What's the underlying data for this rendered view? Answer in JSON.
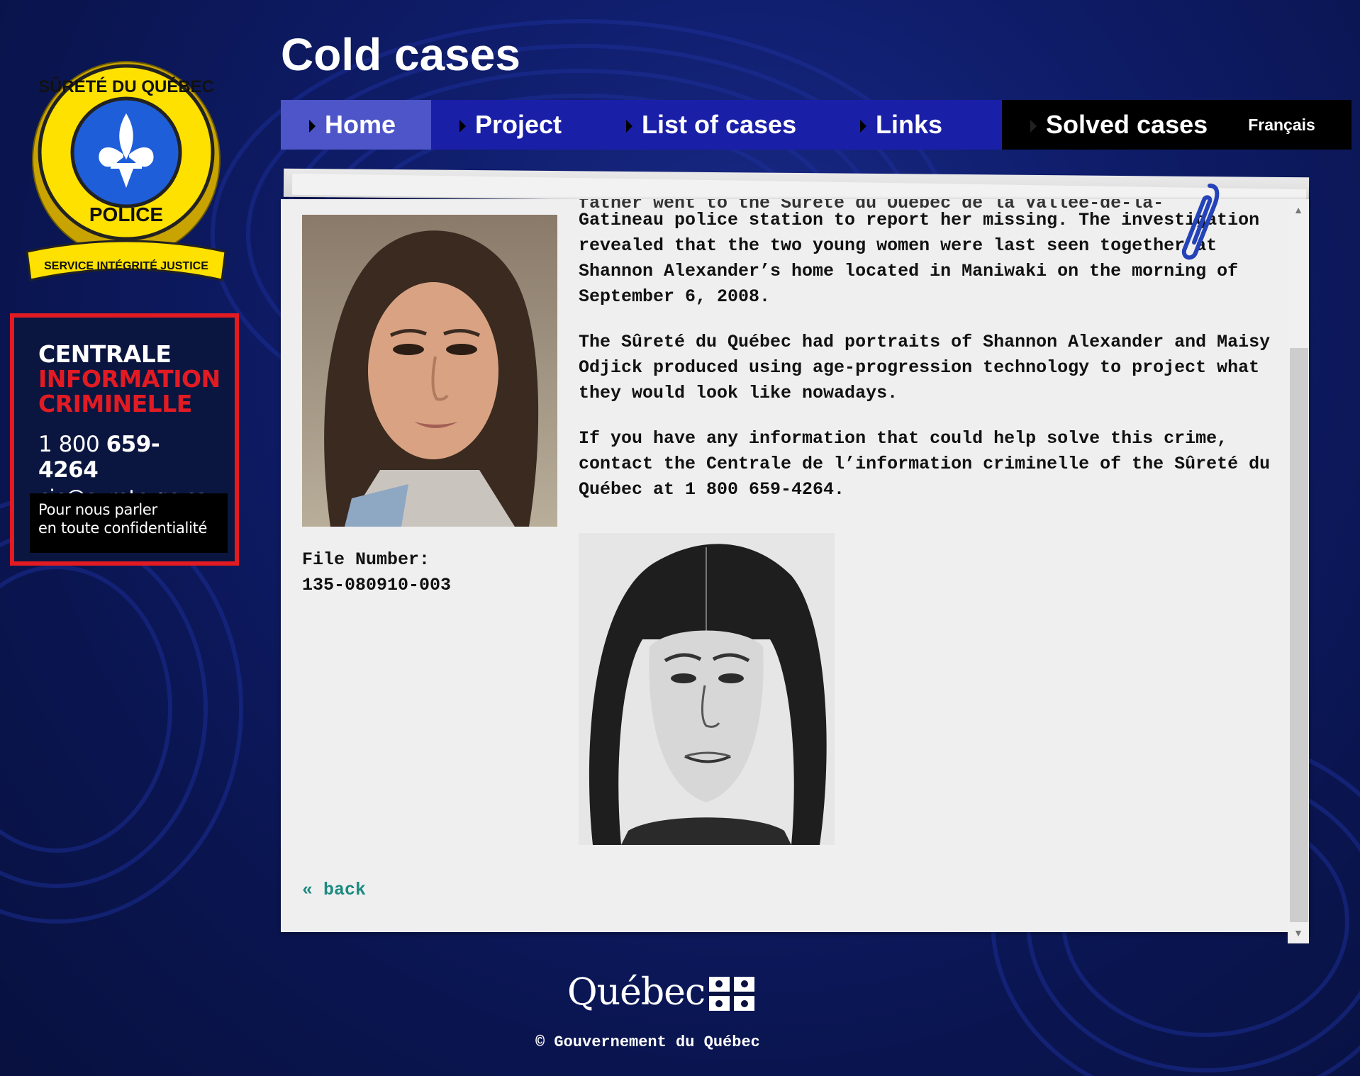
{
  "page_title": "Cold cases",
  "nav": {
    "home": "Home",
    "project": "Project",
    "list_of_cases": "List of cases",
    "links": "Links",
    "solved_cases": "Solved cases",
    "language": "Français"
  },
  "logo": {
    "alt": "Sûreté du Québec Police",
    "ring_text_top": "SÛRETÉ DU QUÉBEC",
    "ring_text_bottom": "POLICE",
    "banner_text": "SERVICE INTÉGRITÉ JUSTICE"
  },
  "cic": {
    "title_line1": "CENTRALE",
    "title_line2": "INFORMATION",
    "title_line3": "CRIMINELLE",
    "phone_prefix": "1 800 ",
    "phone_number": "659-4264",
    "email": "cic@surete.qc.ca",
    "note_line1": "Pour nous parler",
    "note_line2": "en toute confidentialité"
  },
  "case": {
    "cutoff_text": "father went to the Sûreté du Québec de la Vallée-de-la-",
    "paragraph1": "Gatineau police station to report her missing. The investigation revealed that the two young women were last seen together at Shannon Alexander’s home located in Maniwaki on the morning of September 6, 2008.",
    "paragraph2": "The Sûreté du Québec had portraits of Shannon Alexander and Maisy Odjick produced using age-progression technology to project what they would look like nowadays.",
    "paragraph3": "If you have any information that could help solve this crime, contact the Centrale de l’information criminelle of the Sûreté du Québec at 1 800 659-4264.",
    "file_number_label": "File Number:",
    "file_number": "135-080910-003",
    "back_link": "« back"
  },
  "footer": {
    "wordmark": "Québec",
    "copyright": "© Gouvernement du Québec"
  },
  "colors": {
    "background": "#0f1d6b",
    "nav_active": "#4d55c9",
    "nav_default": "#1a1fa8",
    "nav_dark": "#000000",
    "cic_red": "#e21b23",
    "back_link": "#1b8a80"
  }
}
